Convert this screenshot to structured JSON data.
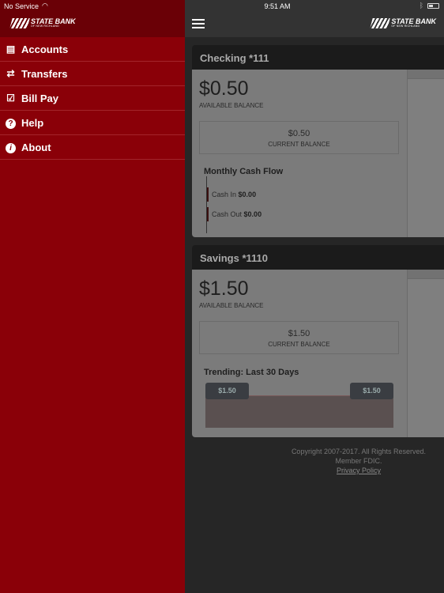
{
  "status_bar": {
    "carrier": "No Service",
    "time": "9:51 AM"
  },
  "brand": {
    "name": "STATE BANK",
    "tagline": "OF NEW RICHLAND"
  },
  "sidebar": {
    "items": [
      {
        "label": "Accounts",
        "icon": "accounts-icon"
      },
      {
        "label": "Transfers",
        "icon": "transfers-icon"
      },
      {
        "label": "Bill Pay",
        "icon": "calendar-check-icon"
      },
      {
        "label": "Help",
        "icon": "help-icon"
      },
      {
        "label": "About",
        "icon": "info-icon"
      }
    ]
  },
  "accounts": [
    {
      "name": "Checking *111",
      "available": "$0.50",
      "available_label": "AVAILABLE BALANCE",
      "current": "$0.50",
      "current_label": "CURRENT BALANCE",
      "section": "Monthly Cash Flow",
      "cash_in_label": "Cash In",
      "cash_in": "$0.00",
      "cash_out_label": "Cash Out",
      "cash_out": "$0.00"
    },
    {
      "name": "Savings *1110",
      "available": "$1.50",
      "available_label": "AVAILABLE BALANCE",
      "current": "$1.50",
      "current_label": "CURRENT BALANCE",
      "section": "Trending: Last 30 Days",
      "trend_start": "$1.50",
      "trend_end": "$1.50"
    }
  ],
  "footer": {
    "copyright": "Copyright 2007-2017. All Rights Reserved.",
    "member": "Member FDIC.",
    "privacy": "Privacy Policy"
  },
  "colors": {
    "sidebar": "#8a0008",
    "sidebar_header": "#6a0006",
    "overlay": "#262626"
  }
}
